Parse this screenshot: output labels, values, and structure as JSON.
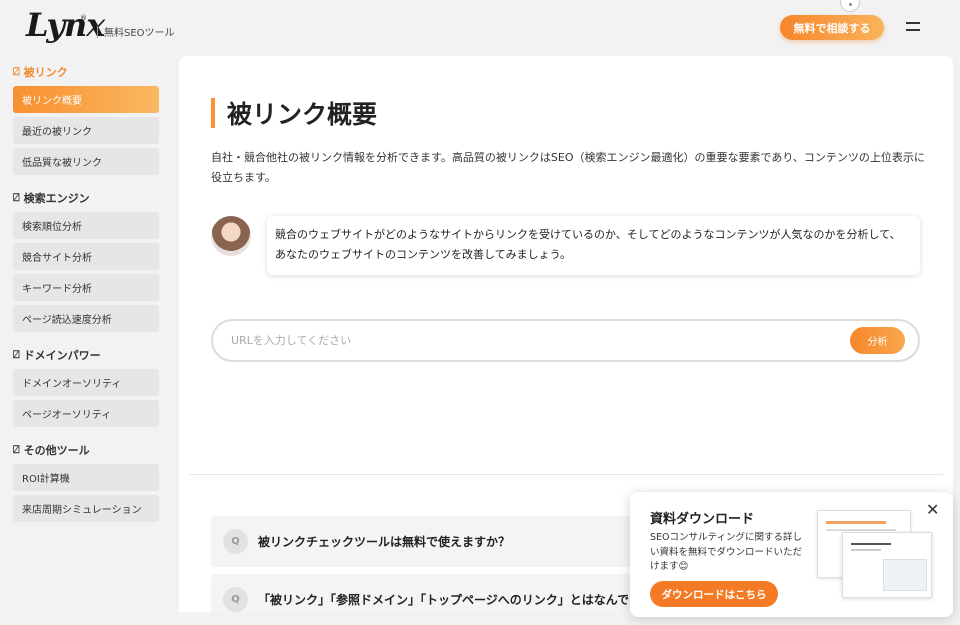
{
  "header": {
    "logo": "Lynx",
    "logo_mark": "®",
    "tagline": "無料SEOツール",
    "consult_button": "無料で相談する"
  },
  "sidebar": {
    "sections": [
      {
        "title": "被リンク",
        "active": true,
        "items": [
          "被リンク概要",
          "最近の被リンク",
          "低品質な被リンク"
        ]
      },
      {
        "title": "検索エンジン",
        "active": false,
        "items": [
          "検索順位分析",
          "競合サイト分析",
          "キーワード分析",
          "ページ読込速度分析"
        ]
      },
      {
        "title": "ドメインパワー",
        "active": false,
        "items": [
          "ドメインオーソリティ",
          "ページオーソリティ"
        ]
      },
      {
        "title": "その他ツール",
        "active": false,
        "items": [
          "ROI計算機",
          "来店周期シミュレーション"
        ]
      }
    ],
    "active_item": "被リンク概要"
  },
  "main": {
    "title": "被リンク概要",
    "description": "自社・競合他社の被リンク情報を分析できます。高品質の被リンクはSEO（検索エンジン最適化）の重要な要素であり、コンテンツの上位表示に役立ちます。",
    "bubble_text": "競合のウェブサイトがどのようなサイトからリンクを受けているのか、そしてどのようなコンテンツが人気なのかを分析して、あなたのウェブサイトのコンテンツを改善してみましょう。",
    "search": {
      "placeholder": "URLを入力してください",
      "value": "",
      "button": "分析"
    },
    "faq": [
      {
        "q": "Q",
        "text": "被リンクチェックツールは無料で使えますか？"
      },
      {
        "q": "Q",
        "text": "「被リンク」「参照ドメイン」「トップページへのリンク」とはなんですか？"
      }
    ]
  },
  "popup": {
    "title": "資料ダウンロード",
    "description": "SEOコンサルティングに関する詳しい資料を無料でダウンロードいただけます😊",
    "button": "ダウンロードはこちら",
    "close": "✕"
  },
  "colors": {
    "accent": "#f7862b",
    "accent_light": "#f9b35c"
  }
}
